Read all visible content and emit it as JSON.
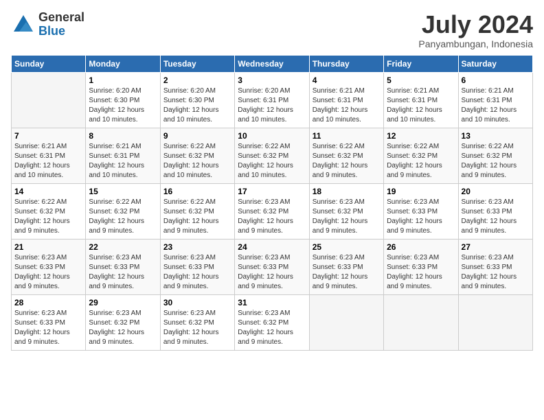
{
  "header": {
    "logo_general": "General",
    "logo_blue": "Blue",
    "month_year": "July 2024",
    "location": "Panyambungan, Indonesia"
  },
  "days_of_week": [
    "Sunday",
    "Monday",
    "Tuesday",
    "Wednesday",
    "Thursday",
    "Friday",
    "Saturday"
  ],
  "weeks": [
    [
      {
        "day": "",
        "info": ""
      },
      {
        "day": "1",
        "info": "Sunrise: 6:20 AM\nSunset: 6:30 PM\nDaylight: 12 hours and 10 minutes."
      },
      {
        "day": "2",
        "info": "Sunrise: 6:20 AM\nSunset: 6:30 PM\nDaylight: 12 hours and 10 minutes."
      },
      {
        "day": "3",
        "info": "Sunrise: 6:20 AM\nSunset: 6:31 PM\nDaylight: 12 hours and 10 minutes."
      },
      {
        "day": "4",
        "info": "Sunrise: 6:21 AM\nSunset: 6:31 PM\nDaylight: 12 hours and 10 minutes."
      },
      {
        "day": "5",
        "info": "Sunrise: 6:21 AM\nSunset: 6:31 PM\nDaylight: 12 hours and 10 minutes."
      },
      {
        "day": "6",
        "info": "Sunrise: 6:21 AM\nSunset: 6:31 PM\nDaylight: 12 hours and 10 minutes."
      }
    ],
    [
      {
        "day": "7",
        "info": "Sunrise: 6:21 AM\nSunset: 6:31 PM\nDaylight: 12 hours and 10 minutes."
      },
      {
        "day": "8",
        "info": "Sunrise: 6:21 AM\nSunset: 6:31 PM\nDaylight: 12 hours and 10 minutes."
      },
      {
        "day": "9",
        "info": "Sunrise: 6:22 AM\nSunset: 6:32 PM\nDaylight: 12 hours and 10 minutes."
      },
      {
        "day": "10",
        "info": "Sunrise: 6:22 AM\nSunset: 6:32 PM\nDaylight: 12 hours and 10 minutes."
      },
      {
        "day": "11",
        "info": "Sunrise: 6:22 AM\nSunset: 6:32 PM\nDaylight: 12 hours and 9 minutes."
      },
      {
        "day": "12",
        "info": "Sunrise: 6:22 AM\nSunset: 6:32 PM\nDaylight: 12 hours and 9 minutes."
      },
      {
        "day": "13",
        "info": "Sunrise: 6:22 AM\nSunset: 6:32 PM\nDaylight: 12 hours and 9 minutes."
      }
    ],
    [
      {
        "day": "14",
        "info": "Sunrise: 6:22 AM\nSunset: 6:32 PM\nDaylight: 12 hours and 9 minutes."
      },
      {
        "day": "15",
        "info": "Sunrise: 6:22 AM\nSunset: 6:32 PM\nDaylight: 12 hours and 9 minutes."
      },
      {
        "day": "16",
        "info": "Sunrise: 6:22 AM\nSunset: 6:32 PM\nDaylight: 12 hours and 9 minutes."
      },
      {
        "day": "17",
        "info": "Sunrise: 6:23 AM\nSunset: 6:32 PM\nDaylight: 12 hours and 9 minutes."
      },
      {
        "day": "18",
        "info": "Sunrise: 6:23 AM\nSunset: 6:32 PM\nDaylight: 12 hours and 9 minutes."
      },
      {
        "day": "19",
        "info": "Sunrise: 6:23 AM\nSunset: 6:33 PM\nDaylight: 12 hours and 9 minutes."
      },
      {
        "day": "20",
        "info": "Sunrise: 6:23 AM\nSunset: 6:33 PM\nDaylight: 12 hours and 9 minutes."
      }
    ],
    [
      {
        "day": "21",
        "info": "Sunrise: 6:23 AM\nSunset: 6:33 PM\nDaylight: 12 hours and 9 minutes."
      },
      {
        "day": "22",
        "info": "Sunrise: 6:23 AM\nSunset: 6:33 PM\nDaylight: 12 hours and 9 minutes."
      },
      {
        "day": "23",
        "info": "Sunrise: 6:23 AM\nSunset: 6:33 PM\nDaylight: 12 hours and 9 minutes."
      },
      {
        "day": "24",
        "info": "Sunrise: 6:23 AM\nSunset: 6:33 PM\nDaylight: 12 hours and 9 minutes."
      },
      {
        "day": "25",
        "info": "Sunrise: 6:23 AM\nSunset: 6:33 PM\nDaylight: 12 hours and 9 minutes."
      },
      {
        "day": "26",
        "info": "Sunrise: 6:23 AM\nSunset: 6:33 PM\nDaylight: 12 hours and 9 minutes."
      },
      {
        "day": "27",
        "info": "Sunrise: 6:23 AM\nSunset: 6:33 PM\nDaylight: 12 hours and 9 minutes."
      }
    ],
    [
      {
        "day": "28",
        "info": "Sunrise: 6:23 AM\nSunset: 6:33 PM\nDaylight: 12 hours and 9 minutes."
      },
      {
        "day": "29",
        "info": "Sunrise: 6:23 AM\nSunset: 6:32 PM\nDaylight: 12 hours and 9 minutes."
      },
      {
        "day": "30",
        "info": "Sunrise: 6:23 AM\nSunset: 6:32 PM\nDaylight: 12 hours and 9 minutes."
      },
      {
        "day": "31",
        "info": "Sunrise: 6:23 AM\nSunset: 6:32 PM\nDaylight: 12 hours and 9 minutes."
      },
      {
        "day": "",
        "info": ""
      },
      {
        "day": "",
        "info": ""
      },
      {
        "day": "",
        "info": ""
      }
    ]
  ]
}
